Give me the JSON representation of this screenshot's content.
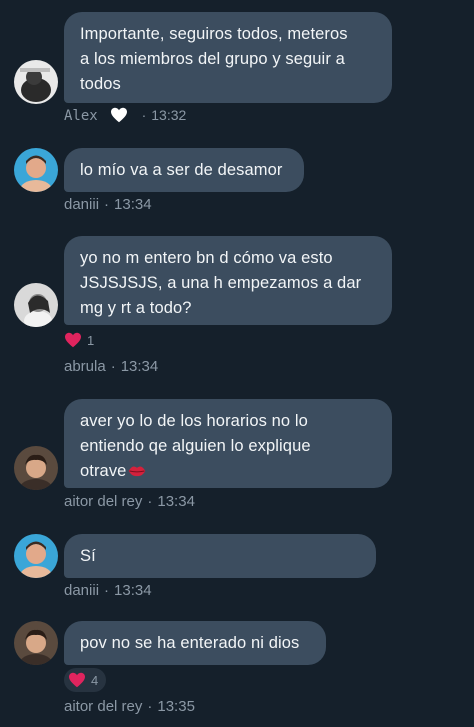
{
  "messages": [
    {
      "lines": [
        "Importante, seguiros todos, meteros",
        "a los miembros del grupo y seguir a",
        "todos"
      ],
      "author": "Alex",
      "time": "13:32",
      "avatar": "alex-avatar"
    },
    {
      "lines": [
        "lo mío va a ser de desamor"
      ],
      "author": "daniii",
      "time": "13:34",
      "avatar": "daniii-avatar"
    },
    {
      "lines": [
        "yo no m entero bn d cómo va esto",
        "JSJSJSJS, a una h empezamos a dar",
        "mg y rt a todo?"
      ],
      "author": "abrula",
      "time": "13:34",
      "avatar": "abrula-avatar",
      "reaction_count": "1"
    },
    {
      "lines": [
        "aver yo lo de los horarios no lo",
        "entiendo qe alguien lo explique",
        "otrave"
      ],
      "author": "aitor del rey",
      "time": "13:34",
      "avatar": "aitor-avatar"
    },
    {
      "lines": [
        "Sí"
      ],
      "author": "daniii",
      "time": "13:34",
      "avatar": "daniii-avatar"
    },
    {
      "lines": [
        "pov no se ha enterado ni dios"
      ],
      "author": "aitor del rey",
      "time": "13:35",
      "avatar": "aitor-avatar",
      "reaction_count": "4"
    }
  ],
  "meta_separator": "·",
  "colors": {
    "background": "#15202b",
    "bubble": "#3c4d5f",
    "meta_text": "#8b98a5",
    "heart_red": "#e0245e"
  }
}
